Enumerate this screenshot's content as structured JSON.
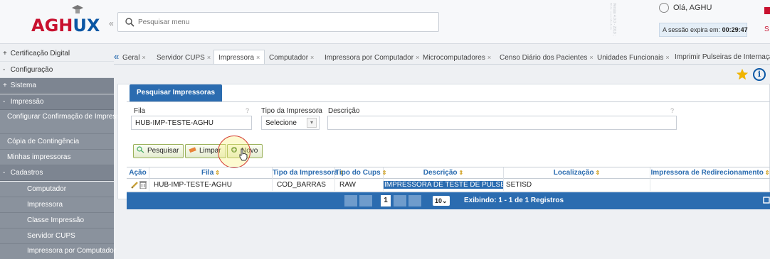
{
  "app": {
    "logo": "AGHUX",
    "logo_sub": "",
    "collapse_glyph": "«"
  },
  "header": {
    "search_placeholder": "Pesquisar menu",
    "greeting": "Olá, AGHU",
    "session_label": "A sessão expira em:",
    "session_time": "00:29:47",
    "exit_letter": "S",
    "side_watermark": "Versão 4.0.0 - 2019 ; Hub: servidorhub"
  },
  "sidebar": {
    "items": [
      {
        "sign": "+",
        "label": "Certificação Digital"
      },
      {
        "sign": "-",
        "label": "Configuração"
      },
      {
        "sign": "+",
        "label": "Sistema"
      },
      {
        "sign": "-",
        "label": "Impressão"
      },
      {
        "label": "Configurar Confirmação de Impressão"
      },
      {
        "label": "Cópia de Contingência"
      },
      {
        "label": "Minhas impressoras"
      },
      {
        "sign": "-",
        "label": "Cadastros"
      },
      {
        "label": "Computador"
      },
      {
        "label": "Impressora"
      },
      {
        "label": "Classe Impressão"
      },
      {
        "label": "Servidor CUPS"
      },
      {
        "label": "Impressora por Computador"
      }
    ]
  },
  "tabs": {
    "arrow": "«",
    "close_glyph": "×",
    "items": [
      {
        "label": "Geral"
      },
      {
        "label": "Servidor CUPS"
      },
      {
        "label": "Impressora"
      },
      {
        "label": "Computador"
      },
      {
        "label": "Impressora por Computador"
      },
      {
        "label": "Microcomputadores"
      },
      {
        "label": "Censo Diário dos Pacientes"
      },
      {
        "label": "Unidades Funcionais"
      },
      {
        "label": "Imprimir Pulseiras de Internação"
      }
    ]
  },
  "toolbar": {
    "info_glyph": "i"
  },
  "form": {
    "title": "Pesquisar Impressoras",
    "fila_label": "Fila",
    "fila_value": "HUB-IMP-TESTE-AGHU",
    "tipo_label": "Tipo da Impressora",
    "tipo_value": "Selecione",
    "descricao_label": "Descrição",
    "descricao_value": "",
    "help_glyph": "?",
    "select_glyph": "▾"
  },
  "buttons": {
    "pesquisar": "Pesquisar",
    "limpar": "Limpar",
    "novo": "Novo"
  },
  "table": {
    "headers": [
      "Ação",
      "Fila",
      "Tipo da Impressora",
      "Tipo do Cups",
      "Descrição",
      "Localização",
      "Impressora de Redirecionamento"
    ],
    "sort_glyph": "⇕",
    "rows": [
      {
        "fila": "HUB-IMP-TESTE-AGHU",
        "tipo": "COD_BARRAS",
        "cups": "RAW",
        "descricao": "IMPRESSORA DE TESTE DE PULSEIRAS A",
        "localizacao": "SETISD",
        "redirecionamento": ""
      }
    ]
  },
  "pager": {
    "page": "1",
    "page_size": "10",
    "page_size_glyph": "⌄",
    "info": "Exibindo: 1 - 1 de 1 Registros"
  },
  "colors": {
    "primary": "#2b6cb0",
    "brand_red": "#c8102e",
    "brand_blue": "#0a56a4",
    "sidebar_dark": "#7d8591"
  },
  "icons": [
    "search-icon",
    "user-icon",
    "exit-icon",
    "star-icon",
    "info-icon",
    "edit-icon",
    "delete-icon",
    "search-button-icon",
    "clear-icon",
    "new-icon",
    "pointer-cursor-icon",
    "refresh-icon"
  ]
}
